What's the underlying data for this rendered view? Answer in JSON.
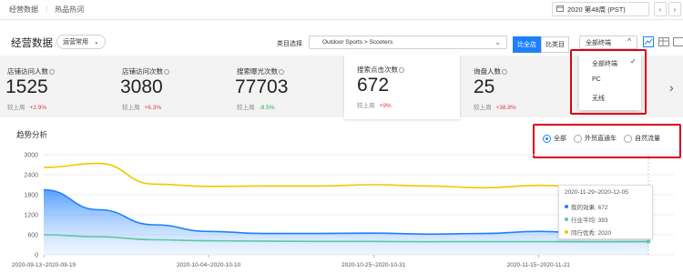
{
  "topbar": {
    "nav": [
      "经营数据",
      "热品热词"
    ],
    "week": "2020 第48周 (PST)",
    "prev": "‹",
    "next": "›"
  },
  "header": {
    "title": "经营数据",
    "business_type": "运营常用",
    "category_label": "类目选择",
    "category_value": "Outdoor Sports > Scooters",
    "compare_all": "比全店",
    "compare_category": "比类目",
    "terminal": "全部终端"
  },
  "terminal_options": [
    "全部终端",
    "PC",
    "无线"
  ],
  "metrics": [
    {
      "label": "店铺访问人数",
      "value": "1525",
      "compare_label": "较上周",
      "change": "+2.9%",
      "dir": "up"
    },
    {
      "label": "店铺访问次数",
      "value": "3080",
      "compare_label": "较上周",
      "change": "+6.3%",
      "dir": "up"
    },
    {
      "label": "搜索曝光次数",
      "value": "77703",
      "compare_label": "较上周",
      "change": "-9.5%",
      "dir": "down"
    },
    {
      "label": "搜索点击次数",
      "value": "672",
      "compare_label": "较上周",
      "change": "+9%",
      "dir": "up"
    },
    {
      "label": "询盘人数",
      "value": "25",
      "compare_label": "较上周",
      "change": "+38.8%",
      "dir": "up"
    }
  ],
  "trend": {
    "title": "趋势分析",
    "filters": [
      "全部",
      "外贸直通车",
      "自然流量"
    ],
    "selected": "全部"
  },
  "tooltip": {
    "period": "2020-11-29~2020-12-05",
    "rows": [
      {
        "label": "我的效果: 672",
        "color": "#1e80ff"
      },
      {
        "label": "行业平均: 393",
        "color": "#5cc9a0"
      },
      {
        "label": "同行优秀: 2020",
        "color": "#f0c800"
      }
    ]
  },
  "chart_data": {
    "type": "area",
    "y_ticks": [
      0,
      600,
      1200,
      1800,
      2400,
      3000
    ],
    "ylim": [
      0,
      3000
    ],
    "x_tick_labels": [
      "2020-09-13~2020-09-19",
      "2020-10-04~2020-10-10",
      "2020-10-25~2020-10-31",
      "2020-11-15~2020-11-21"
    ],
    "x_tick_index": [
      0,
      3,
      6,
      9
    ],
    "series": [
      {
        "name": "同行优秀",
        "color": "#f0c800",
        "values": [
          2620,
          2740,
          2120,
          2050,
          2060,
          2060,
          2100,
          2060,
          2010,
          2080,
          2020,
          2020
        ]
      },
      {
        "name": "我的效果",
        "color": "#1e80ff",
        "values": [
          1950,
          1350,
          900,
          700,
          640,
          640,
          650,
          620,
          640,
          700,
          640,
          672
        ]
      },
      {
        "name": "行业平均",
        "color": "#5cc9a0",
        "values": [
          600,
          540,
          450,
          420,
          410,
          400,
          400,
          390,
          395,
          395,
          390,
          393
        ]
      }
    ]
  }
}
